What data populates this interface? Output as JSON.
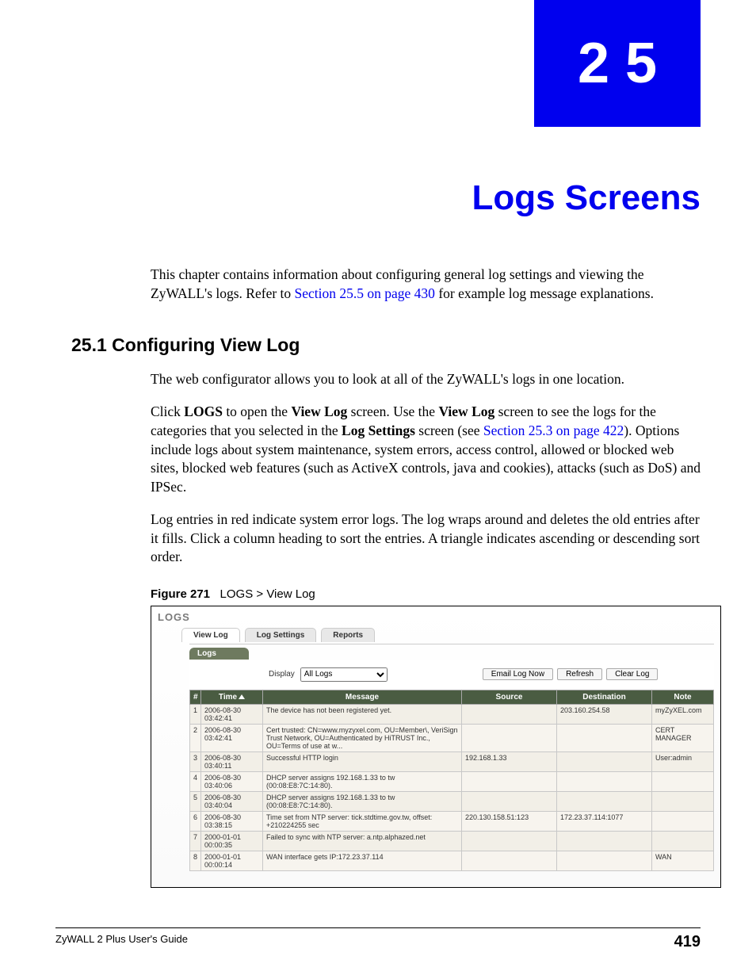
{
  "chapter": {
    "number": "25",
    "title": "Logs Screens"
  },
  "intro": {
    "text_before_ref": "This chapter contains information about configuring general log settings and viewing the ZyWALL's logs. Refer to ",
    "ref": "Section 25.5 on page 430",
    "text_after_ref": " for example log message explanations."
  },
  "section": {
    "heading": "25.1  Configuring View Log",
    "p1": "The web configurator allows you to look at all of the ZyWALL's logs in one location.",
    "p2_a": "Click ",
    "p2_b": "LOGS",
    "p2_c": " to open the ",
    "p2_d": "View Log",
    "p2_e": " screen. Use the ",
    "p2_f": "View Log",
    "p2_g": " screen to see the logs for the categories that you selected in the ",
    "p2_h": "Log Settings",
    "p2_i": " screen (see ",
    "p2_ref": "Section 25.3 on page 422",
    "p2_j": "). Options include logs about system maintenance, system errors, access control, allowed or blocked web sites, blocked web features (such as ActiveX controls, java and cookies), attacks (such as DoS) and IPSec.",
    "p3": "Log entries in red indicate system error logs. The log wraps around and deletes the old entries after it fills. Click a column heading to sort the entries. A triangle indicates ascending or descending sort order."
  },
  "figure": {
    "label": "Figure 271",
    "caption": "LOGS > View Log"
  },
  "screenshot": {
    "title": "LOGS",
    "tabs": [
      "View Log",
      "Log Settings",
      "Reports"
    ],
    "panel_header": "Logs",
    "display_label": "Display",
    "display_value": "All Logs",
    "buttons": {
      "email": "Email Log Now",
      "refresh": "Refresh",
      "clear": "Clear Log"
    },
    "columns": {
      "idx": "#",
      "time": "Time",
      "message": "Message",
      "source": "Source",
      "destination": "Destination",
      "note": "Note"
    },
    "rows": [
      {
        "idx": "1",
        "time": "2006-08-30 03:42:41",
        "message": "The device has not been registered yet.",
        "source": "",
        "destination": "203.160.254.58",
        "note": "myZyXEL.com"
      },
      {
        "idx": "2",
        "time": "2006-08-30 03:42:41",
        "message": "Cert trusted: CN=www.myzyxel.com, OU=Member\\, VeriSign Trust Network, OU=Authenticated by HiTRUST Inc., OU=Terms of use at w...",
        "source": "",
        "destination": "",
        "note": "CERT MANAGER"
      },
      {
        "idx": "3",
        "time": "2006-08-30 03:40:11",
        "message": "Successful HTTP login",
        "source": "192.168.1.33",
        "destination": "",
        "note": "User:admin"
      },
      {
        "idx": "4",
        "time": "2006-08-30 03:40:06",
        "message": "DHCP server assigns 192.168.1.33 to tw (00:08:E8:7C:14:80).",
        "source": "",
        "destination": "",
        "note": ""
      },
      {
        "idx": "5",
        "time": "2006-08-30 03:40:04",
        "message": "DHCP server assigns 192.168.1.33 to tw (00:08:E8:7C:14:80).",
        "source": "",
        "destination": "",
        "note": ""
      },
      {
        "idx": "6",
        "time": "2006-08-30 03:38:15",
        "message": "Time set from NTP server: tick.stdtime.gov.tw, offset: +210224255 sec",
        "source": "220.130.158.51:123",
        "destination": "172.23.37.114:1077",
        "note": ""
      },
      {
        "idx": "7",
        "time": "2000-01-01 00:00:35",
        "message": "Failed to sync with NTP server: a.ntp.alphazed.net",
        "source": "",
        "destination": "",
        "note": ""
      },
      {
        "idx": "8",
        "time": "2000-01-01 00:00:14",
        "message": "WAN interface gets IP:172.23.37.114",
        "source": "",
        "destination": "",
        "note": "WAN"
      }
    ]
  },
  "footer": {
    "guide": "ZyWALL 2 Plus User's Guide",
    "page": "419"
  }
}
